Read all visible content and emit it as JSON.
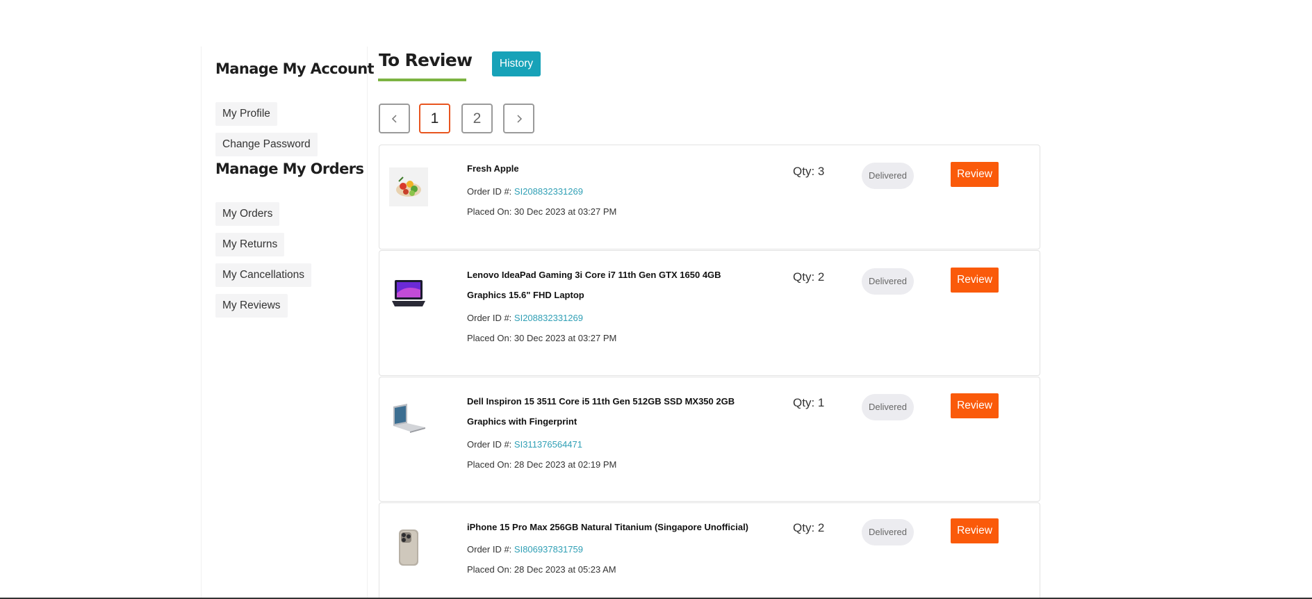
{
  "sidebar": {
    "account_heading": "Manage My Account",
    "account_links": [
      "My Profile",
      "Change Password"
    ],
    "orders_heading": "Manage My Orders",
    "orders_links": [
      "My Orders",
      "My Returns",
      "My Cancellations",
      "My Reviews"
    ]
  },
  "main": {
    "title": "To Review",
    "history_label": "History",
    "accent_color": "#7cb342",
    "history_color": "#17a2b8"
  },
  "pagination": {
    "prev_icon": "chevron-left-icon",
    "pages": [
      "1",
      "2"
    ],
    "current_page": "1",
    "next_icon": "chevron-right-icon"
  },
  "orders": [
    {
      "thumbnail": "fruit-salad-image",
      "name": "Fresh Apple",
      "order_id_label": "Order ID #:",
      "order_id": "SI208832331269",
      "placed_on": "Placed On: 30 Dec 2023 at 03:27 PM",
      "qty": "Qty: 3",
      "status": "Delivered",
      "action": "Review"
    },
    {
      "thumbnail": "gaming-laptop-image",
      "name": "Lenovo IdeaPad Gaming 3i Core i7 11th Gen GTX 1650 4GB Graphics 15.6\" FHD Laptop",
      "order_id_label": "Order ID #:",
      "order_id": "SI208832331269",
      "placed_on": "Placed On: 30 Dec 2023 at 03:27 PM",
      "qty": "Qty: 2",
      "status": "Delivered",
      "action": "Review"
    },
    {
      "thumbnail": "silver-laptop-image",
      "name": "Dell Inspiron 15 3511 Core i5 11th Gen 512GB SSD MX350 2GB Graphics with Fingerprint",
      "order_id_label": "Order ID #:",
      "order_id": "SI311376564471",
      "placed_on": "Placed On: 28 Dec 2023 at 02:19 PM",
      "qty": "Qty: 1",
      "status": "Delivered",
      "action": "Review"
    },
    {
      "thumbnail": "iphone-image",
      "name": "iPhone 15 Pro Max 256GB Natural Titanium (Singapore Unofficial)",
      "order_id_label": "Order ID #:",
      "order_id": "SI806937831759",
      "placed_on": "Placed On: 28 Dec 2023 at 05:23 AM",
      "qty": "Qty: 2",
      "status": "Delivered",
      "action": "Review"
    }
  ],
  "colors": {
    "review_button": "#fa5a0a",
    "active_page_border": "#e8541e",
    "order_id_link": "#2f9fb5"
  }
}
